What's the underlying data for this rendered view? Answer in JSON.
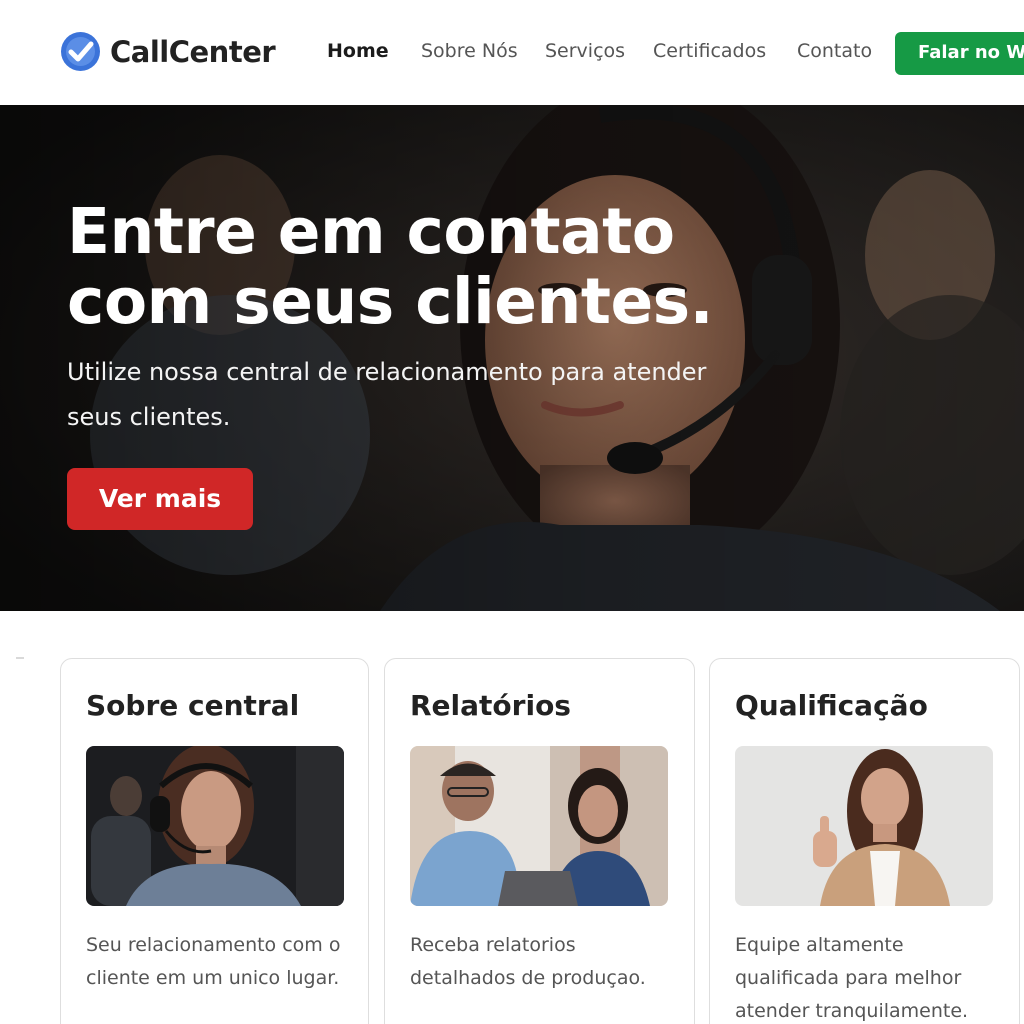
{
  "header": {
    "logo_text": "CallCenter",
    "nav": [
      {
        "label": "Home",
        "active": true
      },
      {
        "label": "Sobre Nós",
        "active": false
      },
      {
        "label": "Serviços",
        "active": false
      },
      {
        "label": "Certificados",
        "active": false
      },
      {
        "label": "Contato",
        "active": false
      }
    ],
    "cta_label": "Falar no WhatsApp"
  },
  "hero": {
    "title_line1": "Entre em contato",
    "title_line2": "com seus clientes.",
    "subtitle": "Utilize nossa central de relacionamento para atender seus clientes.",
    "button_label": "Ver mais"
  },
  "cards": [
    {
      "title": "Sobre central",
      "text": "Seu relacionamento com o cliente em um unico lugar."
    },
    {
      "title": "Relatórios",
      "text": "Receba relatorios detalhados de produçao."
    },
    {
      "title": "Qualificação",
      "text": "Equipe altamente qualificada para melhor atender tranquilamente."
    }
  ],
  "colors": {
    "brand_blue": "#3b73d9",
    "whatsapp_green": "#169a45",
    "hero_button_red": "#d02727"
  }
}
